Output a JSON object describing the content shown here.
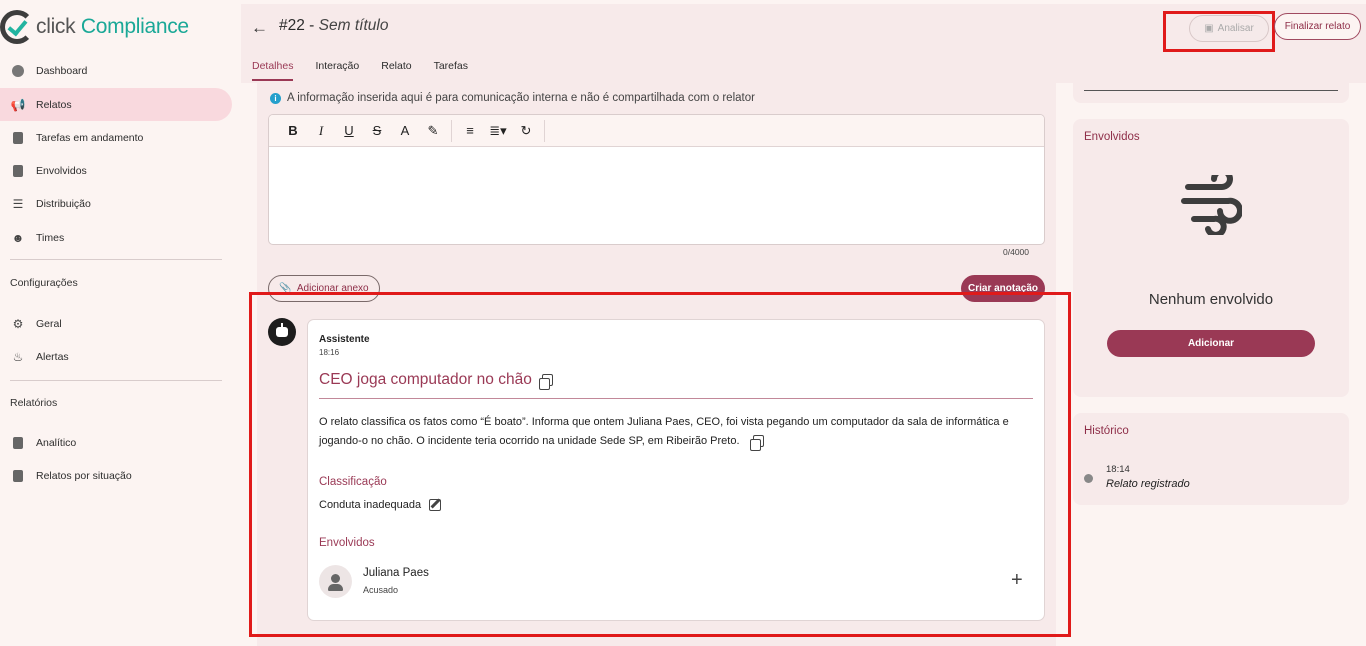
{
  "brand": {
    "name_part1": "click",
    "name_part2": "Compliance"
  },
  "sidebar": {
    "items": [
      {
        "label": "Dashboard",
        "icon": "dashboard-icon"
      },
      {
        "label": "Relatos",
        "icon": "megaphone-icon",
        "active": true
      },
      {
        "label": "Tarefas em andamento",
        "icon": "clipboard-icon"
      },
      {
        "label": "Envolvidos",
        "icon": "clipboard-icon"
      },
      {
        "label": "Distribuição",
        "icon": "distribution-icon"
      },
      {
        "label": "Times",
        "icon": "team-icon"
      }
    ],
    "config_label": "Configurações",
    "config_items": [
      {
        "label": "Geral",
        "icon": "gears-icon"
      },
      {
        "label": "Alertas",
        "icon": "bell-icon"
      }
    ],
    "reports_label": "Relatórios",
    "report_items": [
      {
        "label": "Analítico",
        "icon": "clipboard-icon"
      },
      {
        "label": "Relatos por situação",
        "icon": "clipboard-icon"
      }
    ]
  },
  "header": {
    "number": "#22 -",
    "title": "Sem título",
    "analyze_label": "Analisar",
    "finalize_label": "Finalizar relato",
    "tabs": [
      "Detalhes",
      "Interação",
      "Relato",
      "Tarefas"
    ]
  },
  "notes": {
    "info_text": "A informação inserida aqui é para comunicação interna e não é compartilhada com o relator",
    "char_count": "0/4000",
    "attach_label": "Adicionar anexo",
    "create_label": "Criar anotação"
  },
  "assistant_card": {
    "author": "Assistente",
    "time": "18:16",
    "title": "CEO joga computador no chão",
    "body_line1": "O relato classifica os fatos como “É boato”. Informa que ontem Juliana Paes, CEO, foi vista pegando um computador da sala de informática e",
    "body_line2": "jogando-o no chão. O incidente teria ocorrido na unidade Sede SP, em Ribeirão Preto.",
    "classification_label": "Classificação",
    "classification_value": "Conduta inadequada",
    "involved_label": "Envolvidos",
    "person_name": "Juliana Paes",
    "person_role": "Acusado"
  },
  "involved_panel": {
    "title": "Envolvidos",
    "empty_text": "Nenhum envolvido",
    "add_label": "Adicionar"
  },
  "history_panel": {
    "title": "Histórico",
    "time": "18:14",
    "event": "Relato registrado"
  },
  "colors": {
    "accent": "#9a3955",
    "highlight": "#e01a1a",
    "info": "#25a0cc"
  }
}
